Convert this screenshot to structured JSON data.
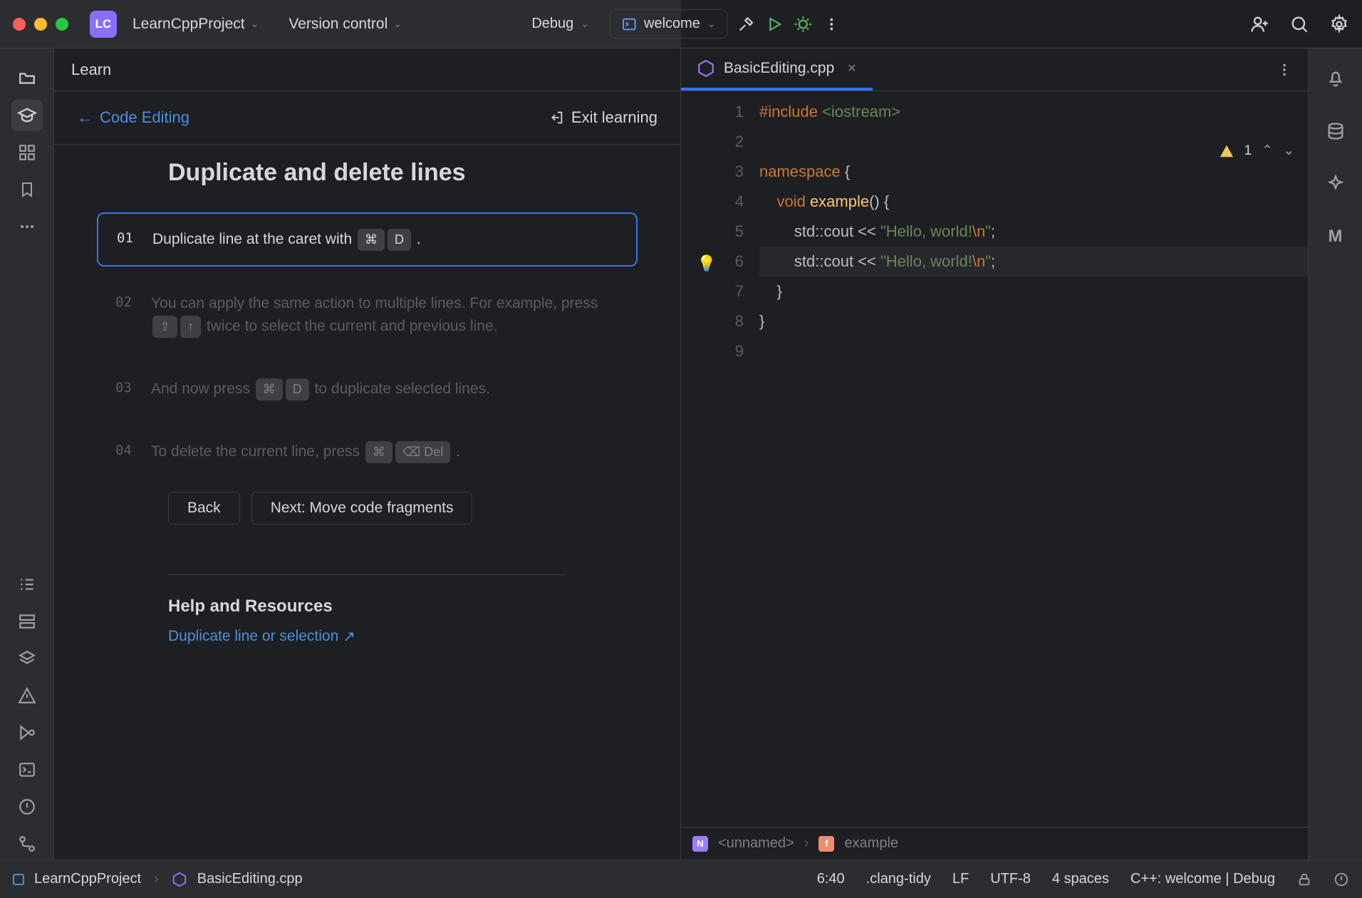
{
  "titlebar": {
    "project_initials": "LC",
    "project_name": "LearnCppProject",
    "version_control": "Version control",
    "run_config": "Debug",
    "active_target": "welcome"
  },
  "learn": {
    "panel_title": "Learn",
    "back_link": "Code Editing",
    "exit_link": "Exit learning",
    "lesson_title": "Duplicate and delete lines",
    "steps": [
      {
        "num": "01",
        "parts": [
          "Duplicate line at the caret with ",
          [
            "⌘",
            "D"
          ],
          " ."
        ]
      },
      {
        "num": "02",
        "parts": [
          "You can apply the same action to multiple lines. For example, press ",
          [
            "⇧",
            "↑"
          ],
          " twice to select the current and previous line."
        ]
      },
      {
        "num": "03",
        "parts": [
          "And now press ",
          [
            "⌘",
            "D"
          ],
          " to duplicate selected lines."
        ]
      },
      {
        "num": "04",
        "parts": [
          "To delete the current line, press ",
          [
            "⌘",
            "⌫ Del"
          ],
          " ."
        ]
      }
    ],
    "back_btn": "Back",
    "next_btn": "Next: Move code fragments",
    "help_title": "Help and Resources",
    "help_link": "Duplicate line or selection"
  },
  "editor": {
    "tab_name": "BasicEditing.cpp",
    "warnings": "1",
    "lines": [
      {
        "n": 1,
        "html": "<span class='kw'>#include</span> <span class='hdr'>&lt;iostream&gt;</span>"
      },
      {
        "n": 2,
        "html": ""
      },
      {
        "n": 3,
        "html": "<span class='kw'>namespace</span> {"
      },
      {
        "n": 4,
        "html": "    <span class='kw'>void</span> <span class='fn'>example</span>() {"
      },
      {
        "n": 5,
        "html": "        std::cout &lt;&lt; <span class='str'>\"Hello, world!</span><span class='esc'>\\n</span><span class='str'>\"</span>;"
      },
      {
        "n": 6,
        "html": "        std::cout &lt;&lt; <span class='str'>\"Hello, world!</span><span class='esc'>\\n</span><span class='str'>\"</span>;",
        "caret": true
      },
      {
        "n": 7,
        "html": "    }"
      },
      {
        "n": 8,
        "html": "}"
      },
      {
        "n": 9,
        "html": ""
      }
    ],
    "breadcrumb_ns": "<unnamed>",
    "breadcrumb_fn": "example"
  },
  "status": {
    "project": "LearnCppProject",
    "file": "BasicEditing.cpp",
    "caret": "6:40",
    "clang": ".clang-tidy",
    "line_end": "LF",
    "encoding": "UTF-8",
    "indent": "4 spaces",
    "context": "C++: welcome | Debug"
  }
}
